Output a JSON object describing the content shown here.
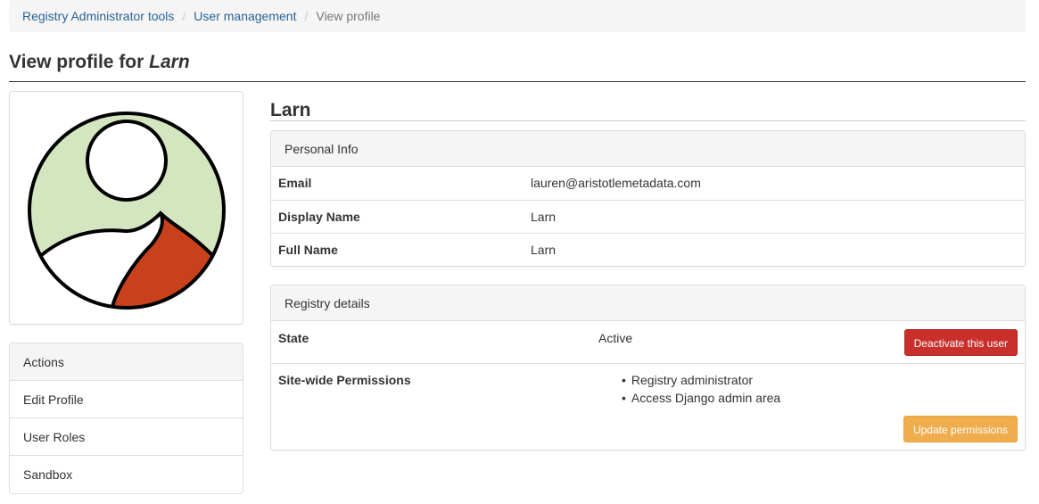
{
  "breadcrumb": {
    "items": [
      "Registry Administrator tools",
      "User management"
    ],
    "active": "View profile"
  },
  "title": {
    "prefix": "View profile for ",
    "name": "Larn"
  },
  "actions": {
    "heading": "Actions",
    "items": [
      "Edit Profile",
      "User Roles",
      "Sandbox"
    ]
  },
  "user": {
    "name": "Larn"
  },
  "personal_info": {
    "heading": "Personal Info",
    "rows": [
      {
        "label": "Email",
        "value": "lauren@aristotlemetadata.com"
      },
      {
        "label": "Display Name",
        "value": "Larn"
      },
      {
        "label": "Full Name",
        "value": "Larn"
      }
    ]
  },
  "registry_details": {
    "heading": "Registry details",
    "state_label": "State",
    "state_value": "Active",
    "deactivate_button": "Deactivate this user",
    "permissions_label": "Site-wide Permissions",
    "permissions": [
      "Registry administrator",
      "Access Django admin area"
    ],
    "update_button": "Update permissions"
  },
  "colors": {
    "link": "#2a6496",
    "danger": "#c9302c",
    "warning": "#f0ad4e",
    "avatar_bg": "#d3e6c0",
    "avatar_accent": "#c9411c"
  },
  "icons": {
    "avatar": "user-avatar-icon"
  }
}
